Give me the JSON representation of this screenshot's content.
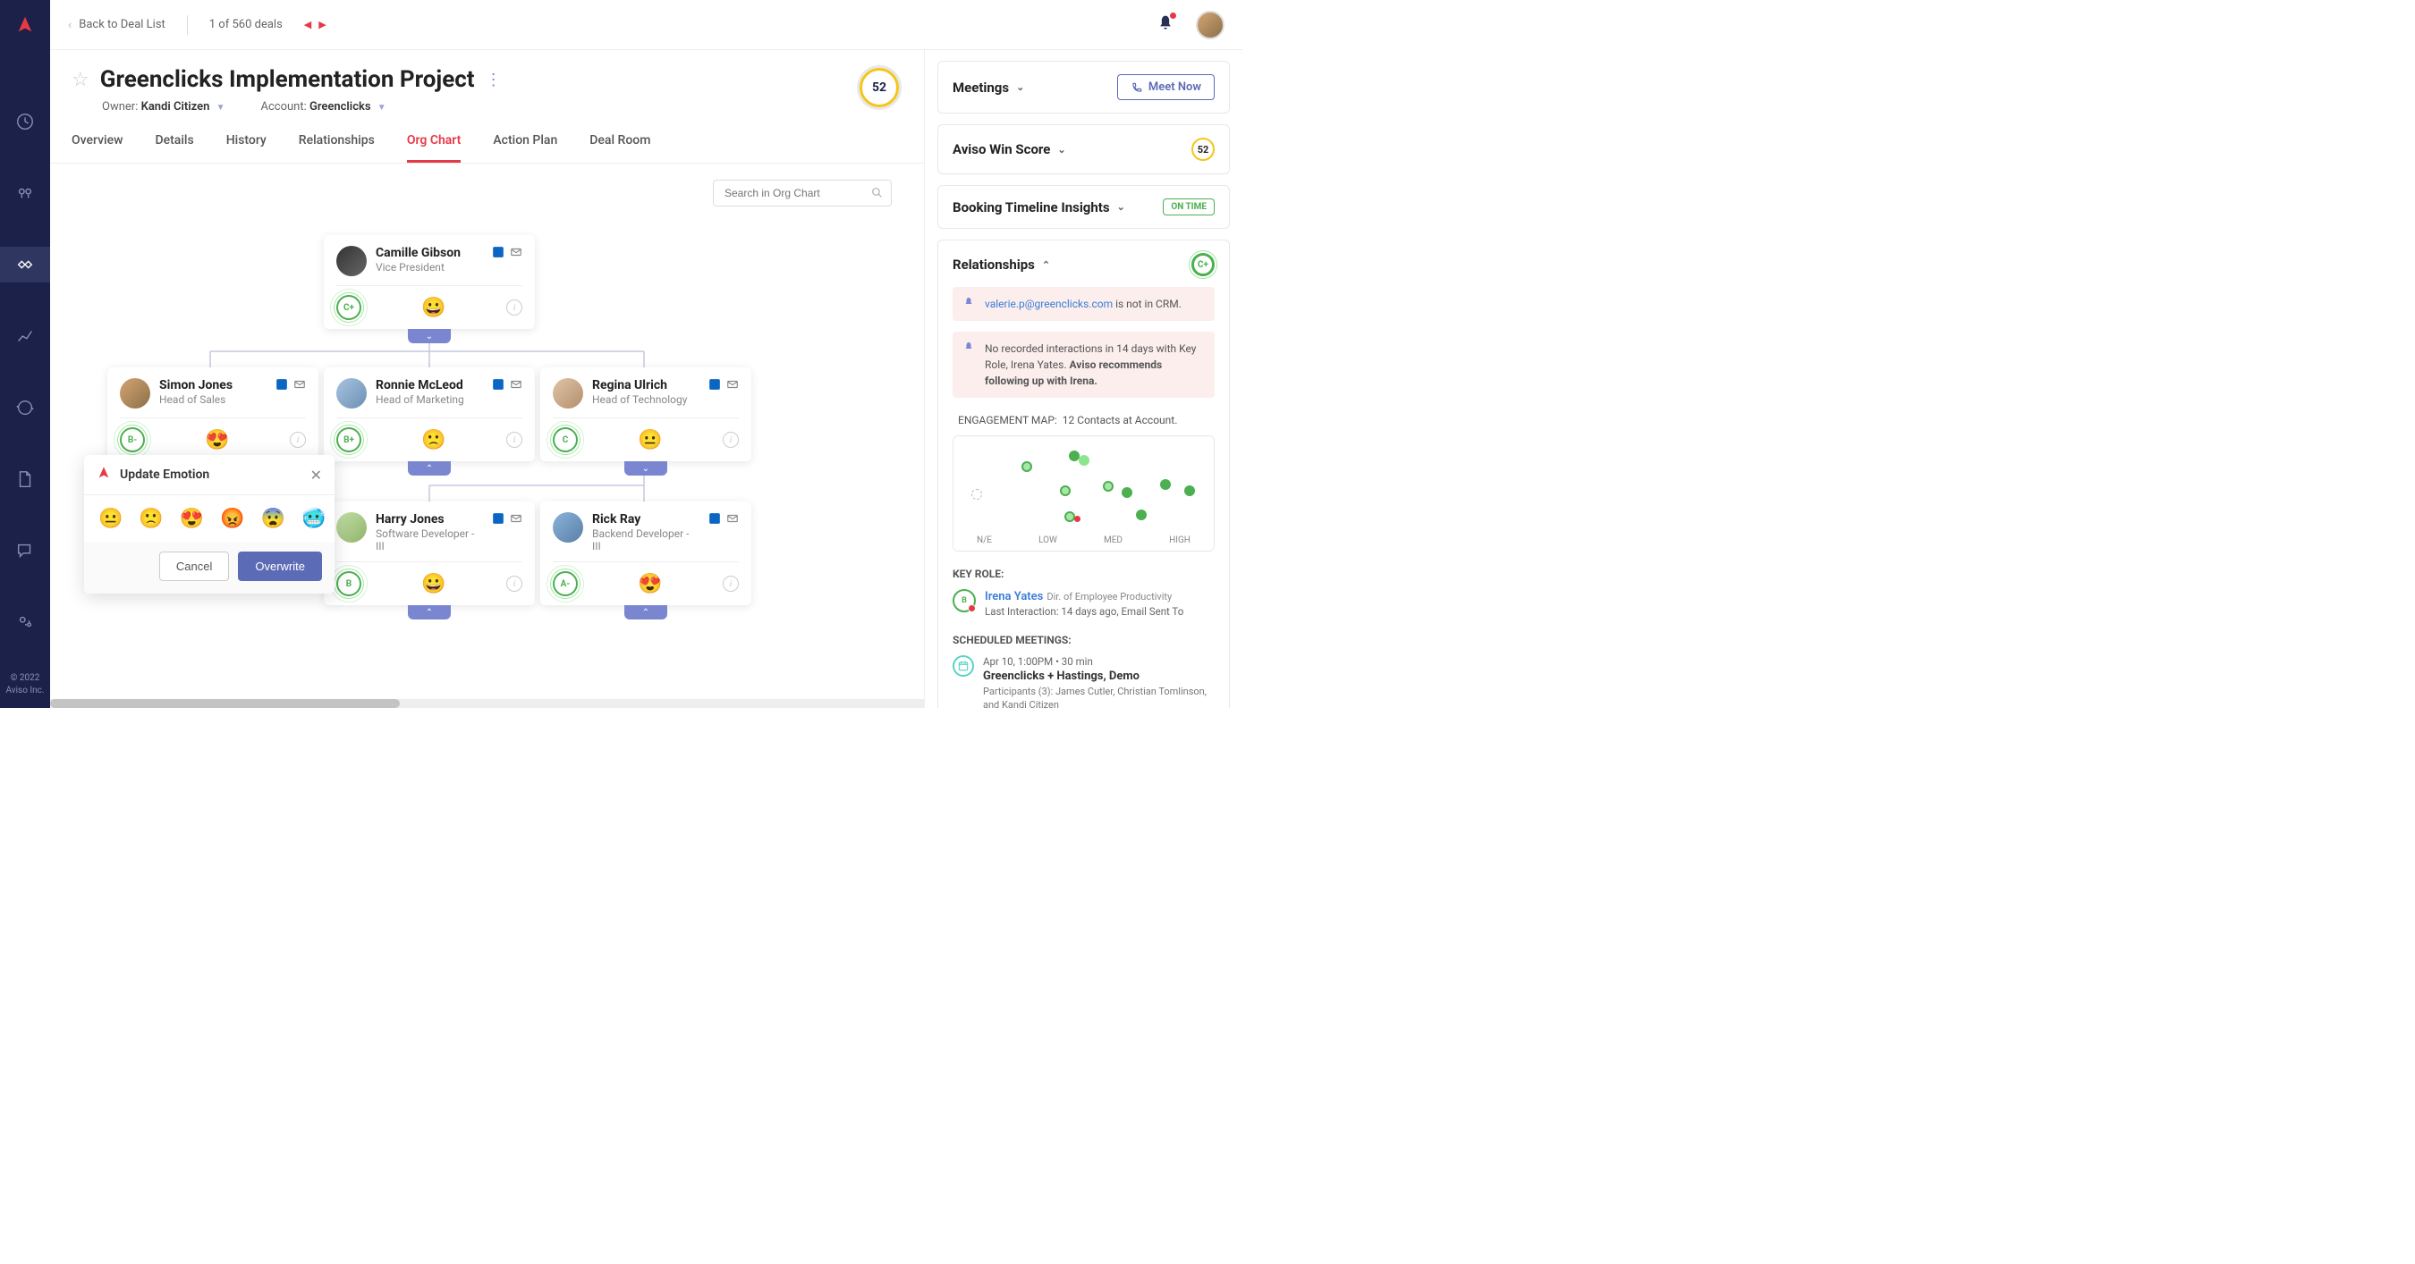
{
  "topbar": {
    "back_label": "Back to Deal List",
    "deal_count": "1 of 560 deals"
  },
  "deal": {
    "title": "Greenclicks Implementation Project",
    "owner_label": "Owner:",
    "owner": "Kandi Citizen",
    "account_label": "Account:",
    "account": "Greenclicks",
    "score": "52"
  },
  "tabs": {
    "overview": "Overview",
    "details": "Details",
    "history": "History",
    "relationships": "Relationships",
    "orgchart": "Org Chart",
    "actionplan": "Action Plan",
    "dealroom": "Deal Room"
  },
  "search": {
    "placeholder": "Search in Org Chart"
  },
  "nodes": {
    "camille": {
      "name": "Camille Gibson",
      "title": "Vice President",
      "grade": "C+",
      "emoji": "😀"
    },
    "simon": {
      "name": "Simon Jones",
      "title": "Head of Sales",
      "grade": "B-",
      "emoji": "😍"
    },
    "ronnie": {
      "name": "Ronnie McLeod",
      "title": "Head of Marketing",
      "grade": "B+",
      "emoji": "🙁"
    },
    "regina": {
      "name": "Regina Ulrich",
      "title": "Head of Technology",
      "grade": "C",
      "emoji": "😐"
    },
    "harry": {
      "name": "Harry Jones",
      "title": "Software Developer - III",
      "grade": "B",
      "emoji": "😀"
    },
    "rick": {
      "name": "Rick Ray",
      "title": "Backend Developer - III",
      "grade": "A-",
      "emoji": "😍"
    }
  },
  "popover": {
    "title": "Update Emotion",
    "emojis": {
      "e1": "😐",
      "e2": "🙁",
      "e3": "😍",
      "e4": "😡",
      "e5": "😨",
      "e6": "🥶"
    },
    "cancel": "Cancel",
    "overwrite": "Overwrite"
  },
  "right": {
    "meetings": {
      "label": "Meetings",
      "meet_now": "Meet Now"
    },
    "winscore": {
      "label": "Aviso Win Score",
      "value": "52"
    },
    "booking": {
      "label": "Booking Timeline Insights",
      "pill": "ON TIME"
    },
    "relationships": {
      "label": "Relationships",
      "grade": "C+",
      "alert1_email": "valerie.p@greenclicks.com",
      "alert1_rest": " is not in CRM.",
      "alert2": "No recorded interactions in 14 days with Key Role, Irena Yates. ",
      "alert2_bold": "Aviso recommends following up with Irena.",
      "map_label": "ENGAGEMENT MAP:",
      "map_count": "12 Contacts at Account.",
      "axis": {
        "ne": "N/E",
        "low": "LOW",
        "med": "MED",
        "high": "HIGH"
      },
      "keyrole_label": "KEY ROLE:",
      "keyrole": {
        "grade": "B",
        "name": "Irena Yates",
        "title": "Dir. of Employee Productivity",
        "sub": "Last Interaction: 14 days ago, Email Sent To"
      },
      "sched_label": "SCHEDULED MEETINGS:",
      "meeting": {
        "time": "Apr 10, 1:00PM  •  30 min",
        "title": "Greenclicks + Hastings, Demo",
        "participants": "Participants (3): James Cutler, Christian Tomlinson, and Kandi Citizen"
      }
    }
  },
  "footer": {
    "copyright": "© 2022",
    "company": "Aviso Inc."
  }
}
